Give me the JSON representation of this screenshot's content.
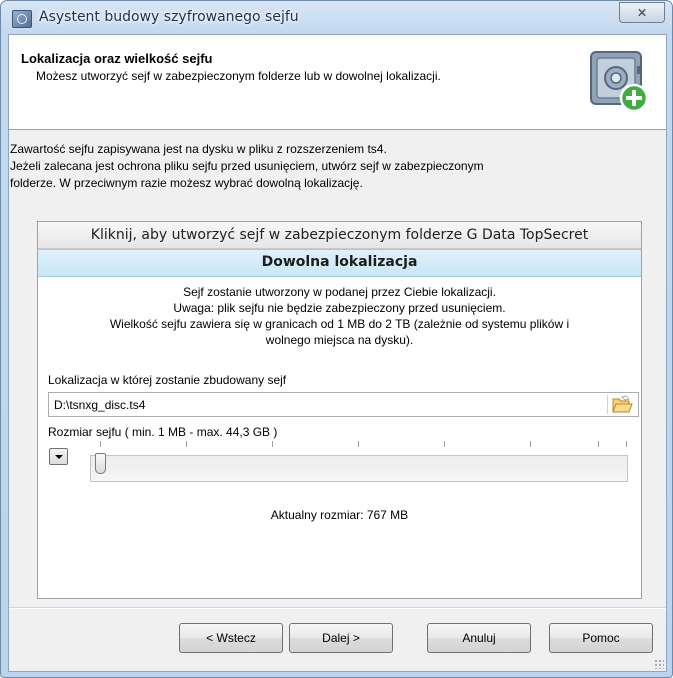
{
  "window": {
    "title": "Asystent budowy szyfrowanego sejfu",
    "close_symbol": "⨯"
  },
  "header": {
    "title": "Lokalizacja oraz wielkość sejfu",
    "subtitle": "Możesz utworzyć sejf w zabezpieczonym folderze lub w dowolnej lokalizacji.",
    "icon": "safe-add-icon"
  },
  "intro": {
    "line1": "Zawartość sejfu zapisywana jest na dysku w pliku z rozszerzeniem ts4.",
    "line2": "Jeżeli zalecana jest ochrona pliku sejfu przed usunięciem, utwórz sejf w zabezpieczonym",
    "line3": "folderze. W przeciwnym razie możesz wybrać dowolną lokalizację."
  },
  "options": {
    "protected_folder": "Kliknij, aby utworzyć sejf w zabezpieczonym folderze G Data TopSecret",
    "custom_location": "Dowolna lokalizacja"
  },
  "info": {
    "line1": "Sejf zostanie utworzony w podanej przez Ciebie lokalizacji.",
    "line2": "Uwaga: plik sejfu nie będzie zabezpieczony przed usunięciem.",
    "line3": "Wielkość sejfu zawiera się w granicach od 1 MB do 2 TB (zależnie od systemu plików i",
    "line4": "wolnego miejsca na dysku)."
  },
  "location": {
    "label": "Lokalizacja w której zostanie zbudowany sejf",
    "value": "D:\\tsnxg_disc.ts4",
    "browse_icon": "folder-open-icon"
  },
  "size": {
    "label": "Rozmiar sejfu ( min. 1 MB - max. 44,3 GB )",
    "slider_fraction": 0.0,
    "current": "Aktualny rozmiar: 767 MB"
  },
  "buttons": {
    "back": "< Wstecz",
    "next": "Dalej >",
    "cancel": "Anuluj",
    "help": "Pomoc"
  },
  "colors": {
    "active_option": "#c9e6f6",
    "header_bg": "#ffffff",
    "dialog_bg": "#f0f0f0"
  }
}
